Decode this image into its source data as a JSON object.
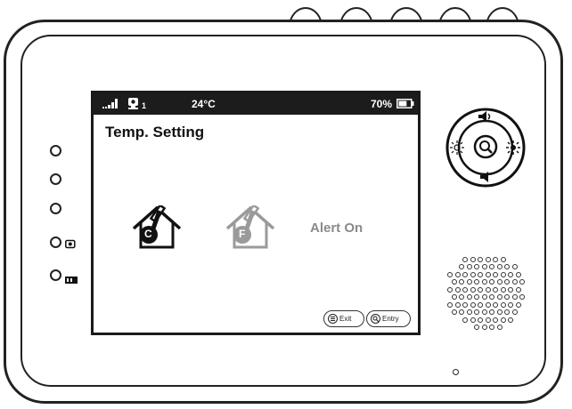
{
  "status_bar": {
    "signal_icon": "signal-bars-icon",
    "camera_icon": "camera-icon",
    "camera_index": "1",
    "temperature": "24°C",
    "battery_percent": "70%",
    "battery_icon": "battery-icon",
    "battery_level": 0.7
  },
  "screen": {
    "title": "Temp. Setting",
    "options": [
      {
        "icon": "celsius-house-icon",
        "letter": "C",
        "selected": true
      },
      {
        "icon": "fahrenheit-house-icon",
        "letter": "F",
        "selected": false
      }
    ],
    "alert_label": "Alert On",
    "footer": {
      "exit_label": "Exit",
      "entry_label": "Entry",
      "exit_icon": "menu-icon",
      "entry_icon": "zoom-icon"
    }
  },
  "side_buttons": [
    {
      "icon": "button-icon"
    },
    {
      "icon": "button-icon"
    },
    {
      "icon": "button-icon"
    },
    {
      "icon": "camera-icon"
    },
    {
      "icon": "video-icon"
    }
  ],
  "nav_pad": {
    "up_icon": "volume-up-icon",
    "down_icon": "volume-down-icon",
    "left_icon": "brightness-down-icon",
    "right_icon": "brightness-up-icon",
    "center_icon": "zoom-icon"
  },
  "speaker_icon": "speaker-grille-icon",
  "mic_icon": "microphone-hole-icon"
}
